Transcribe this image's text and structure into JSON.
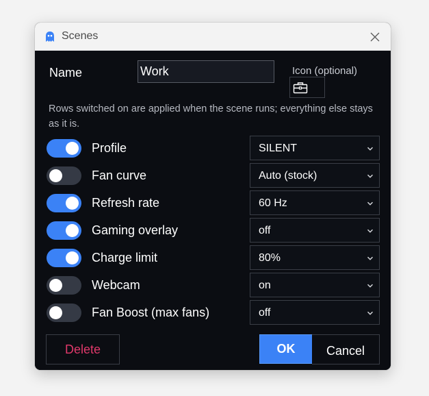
{
  "window": {
    "title": "Scenes",
    "icon": "ghost-icon",
    "close_icon": "close-icon"
  },
  "form": {
    "name_label": "Name",
    "name_value": "Work",
    "icon_label": "Icon (optional)",
    "icon_value": "briefcase-icon",
    "hint": "Rows switched on are applied when the scene runs; everything else stays as it is."
  },
  "rows": [
    {
      "label": "Profile",
      "enabled": true,
      "value": "SILENT"
    },
    {
      "label": "Fan curve",
      "enabled": false,
      "value": "Auto (stock)"
    },
    {
      "label": "Refresh rate",
      "enabled": true,
      "value": "60 Hz"
    },
    {
      "label": "Gaming overlay",
      "enabled": true,
      "value": "off"
    },
    {
      "label": "Charge limit",
      "enabled": true,
      "value": "80%"
    },
    {
      "label": "Webcam",
      "enabled": false,
      "value": "on"
    },
    {
      "label": "Fan Boost (max fans)",
      "enabled": false,
      "value": "off"
    }
  ],
  "buttons": {
    "delete": "Delete",
    "ok": "OK",
    "cancel": "Cancel"
  },
  "colors": {
    "accent": "#3b82f6",
    "danger": "#e0396b",
    "background": "#0b0d12",
    "toggle_off": "#353a45"
  }
}
